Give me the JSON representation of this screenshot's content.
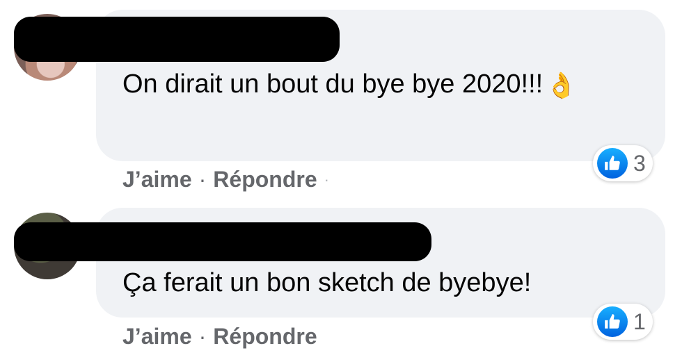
{
  "comments": [
    {
      "text": "On dirait un bout du bye bye 2020!!!",
      "emoji": "👌",
      "like_label": "J’aime",
      "separator": "·",
      "reply_label": "Répondre",
      "trail": "·",
      "reaction_icon": "like-icon",
      "reaction_count": "3"
    },
    {
      "text": "Ça ferait un bon sketch de byebye!",
      "like_label": "J’aime",
      "separator": "·",
      "reply_label": "Répondre",
      "reaction_icon": "like-icon",
      "reaction_count": "1"
    }
  ],
  "colors": {
    "bubble": "#f0f2f5",
    "action_text": "#65676b",
    "like_blue": "#1877f2"
  }
}
